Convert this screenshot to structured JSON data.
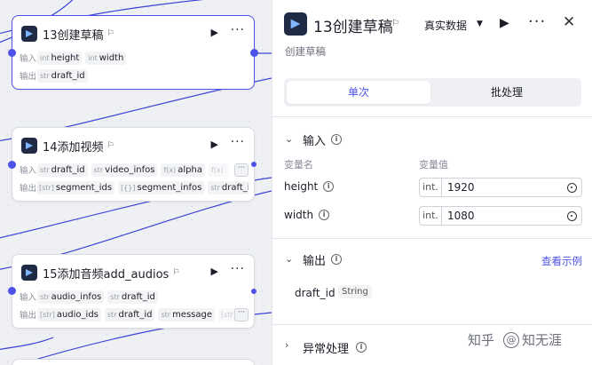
{
  "canvas": {
    "nodes": [
      {
        "title": "13创建草稿",
        "inputs_label": "输入",
        "outputs_label": "输出",
        "inputs": [
          {
            "type": "int",
            "name": "height"
          },
          {
            "type": "int",
            "name": "width"
          }
        ],
        "outputs": [
          {
            "type": "str",
            "name": "draft_id"
          }
        ]
      },
      {
        "title": "14添加视频",
        "inputs_label": "输入",
        "outputs_label": "输出",
        "inputs": [
          {
            "type": "str",
            "name": "draft_id"
          },
          {
            "type": "str",
            "name": "video_infos"
          },
          {
            "type": "f(x)",
            "name": "alpha"
          },
          {
            "type": "f(x)",
            "name": ""
          }
        ],
        "outputs": [
          {
            "type": "[str]",
            "name": "segment_ids"
          },
          {
            "type": "[{}]",
            "name": "segment_infos"
          },
          {
            "type": "str",
            "name": "draft_id"
          }
        ]
      },
      {
        "title": "15添加音频add_audios",
        "inputs_label": "输入",
        "outputs_label": "输出",
        "inputs": [
          {
            "type": "str",
            "name": "audio_infos"
          },
          {
            "type": "str",
            "name": "draft_id"
          }
        ],
        "outputs": [
          {
            "type": "[str]",
            "name": "audio_ids"
          },
          {
            "type": "str",
            "name": "draft_id"
          },
          {
            "type": "str",
            "name": "message"
          },
          {
            "type": "[str]",
            "name": ""
          }
        ]
      }
    ],
    "more_label": "···"
  },
  "panel": {
    "title": "13创建草稿",
    "run_mode": "真实数据",
    "description": "创建草稿",
    "tabs": [
      {
        "label": "单次",
        "active": true
      },
      {
        "label": "批处理",
        "active": false
      }
    ],
    "input_section": {
      "title": "输入",
      "col_name": "变量名",
      "col_value": "变量值",
      "fields": [
        {
          "name": "height",
          "type": "int.",
          "value": "1920"
        },
        {
          "name": "width",
          "type": "int.",
          "value": "1080"
        }
      ]
    },
    "output_section": {
      "title": "输出",
      "view_example": "查看示例",
      "outputs": [
        {
          "name": "draft_id",
          "type": "String"
        }
      ]
    },
    "error_section": {
      "title": "异常处理"
    },
    "watermark": {
      "brand": "知乎",
      "handle": "知无涯"
    }
  },
  "colors": {
    "accent": "#4d53e8",
    "edge": "#3b44d6",
    "canvas_bg": "#eef0f4",
    "icon_bg": "#1f2a44"
  },
  "icons": [
    "node-app-icon",
    "flag-icon",
    "play-icon",
    "more-icon",
    "close-icon",
    "chevron-down-icon",
    "info-icon",
    "target-icon"
  ]
}
